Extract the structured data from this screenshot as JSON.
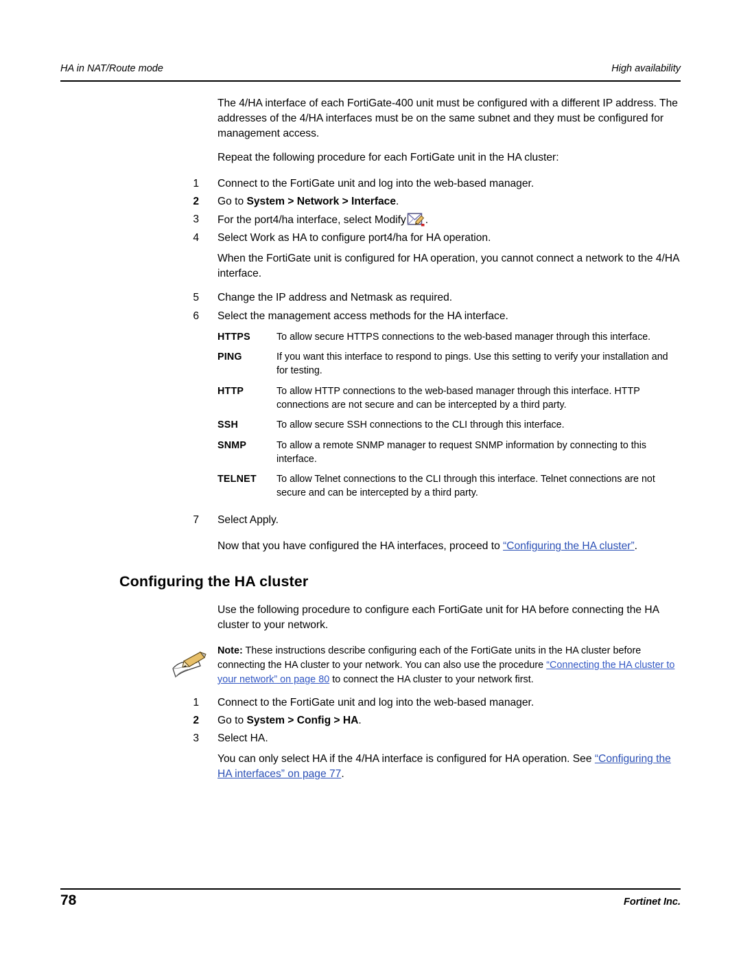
{
  "header": {
    "left": "HA in NAT/Route mode",
    "right": "High availability"
  },
  "body": {
    "intro_para": "The 4/HA interface of each FortiGate-400 unit must be configured with a different IP address. The addresses of the 4/HA interfaces must be on the same subnet and they must be configured for management access.",
    "repeat_para": "Repeat the following procedure for each FortiGate unit in the HA cluster:",
    "steps": [
      {
        "num": "1",
        "text": "Connect to the FortiGate unit and log into the web-based manager."
      },
      {
        "num": "2",
        "prefix": "Go to ",
        "bold_text": "System > Network > Interface",
        "suffix": "."
      },
      {
        "num": "3",
        "text": "For the port4/ha interface, select Modify"
      },
      {
        "num": "4",
        "text": "Select Work as HA to configure port4/ha for HA operation."
      },
      {
        "num": "5",
        "text": "Change the IP address and Netmask as required."
      },
      {
        "num": "6",
        "text": "Select the management access methods for the HA interface."
      },
      {
        "num": "7",
        "text": "Select Apply."
      }
    ],
    "ha_note_para": "When the FortiGate unit is configured for HA operation, you cannot connect a network to the 4/HA interface.",
    "access_methods": [
      {
        "term": "HTTPS",
        "desc": "To allow secure HTTPS connections to the web-based manager through this interface."
      },
      {
        "term": "PING",
        "desc": "If you want this interface to respond to pings. Use this setting to verify your installation and for testing."
      },
      {
        "term": "HTTP",
        "desc": "To allow HTTP connections to the web-based manager through this interface. HTTP connections are not secure and can be intercepted by a third party."
      },
      {
        "term": "SSH",
        "desc": "To allow secure SSH connections to the CLI through this interface."
      },
      {
        "term": "SNMP",
        "desc": "To allow a remote SNMP manager to request SNMP information by connecting to this interface."
      },
      {
        "term": "TELNET",
        "desc": "To allow Telnet connections to the CLI through this interface. Telnet connections are not secure and can be intercepted by a third party."
      }
    ],
    "proceed_text": "Now that you have configured the HA interfaces, proceed to ",
    "proceed_link": "“Configuring the HA cluster”",
    "proceed_suffix": ".",
    "section_heading": "Configuring the HA cluster",
    "cluster_intro": "Use the following procedure to configure each FortiGate unit for HA before connecting the HA cluster to your network.",
    "note": {
      "label": "Note:",
      "text_1": " These instructions describe configuring each of the FortiGate units in the HA cluster before connecting the HA cluster to your network. You can also use the procedure ",
      "link_1": "“Connecting the HA cluster to your network” on page 80",
      "text_2": " to connect the HA cluster to your network first."
    },
    "cluster_steps": [
      {
        "num": "1",
        "text": "Connect to the FortiGate unit and log into the web-based manager."
      },
      {
        "num": "2",
        "prefix": "Go to ",
        "bold_text": "System > Config > HA",
        "suffix": "."
      },
      {
        "num": "3",
        "text": "Select HA."
      }
    ],
    "cluster_closing": "You can only select HA if the 4/HA interface is configured for HA operation. See ",
    "cluster_closing_link": "“Configuring the HA interfaces” on page 77",
    "cluster_closing_suffix": "."
  },
  "footer": {
    "page_number": "78",
    "right": "Fortinet Inc."
  }
}
